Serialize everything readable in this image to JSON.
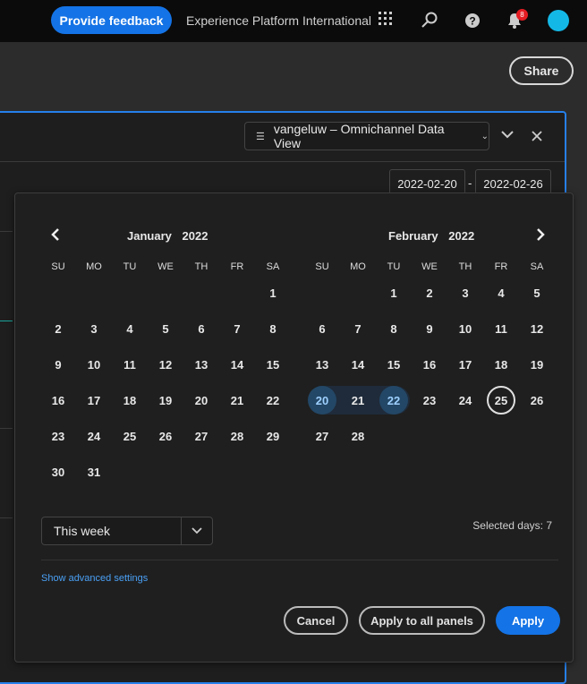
{
  "topbar": {
    "feedback_label": "Provide feedback",
    "org_name": "Experience Platform International",
    "notification_count": "8"
  },
  "toolbar": {
    "share_label": "Share"
  },
  "panel": {
    "data_view": "vangeluw – Omnichannel Data View",
    "start_date": "2022-02-20",
    "date_separator": "-",
    "end_date": "2022-02-26"
  },
  "calendar": {
    "weekdays": [
      "SU",
      "MO",
      "TU",
      "WE",
      "TH",
      "FR",
      "SA"
    ],
    "months": [
      {
        "month": "January",
        "year": "2022",
        "weeks": [
          [
            "",
            "",
            "",
            "",
            "",
            "",
            "1"
          ],
          [
            "2",
            "3",
            "4",
            "5",
            "6",
            "7",
            "8"
          ],
          [
            "9",
            "10",
            "11",
            "12",
            "13",
            "14",
            "15"
          ],
          [
            "16",
            "17",
            "18",
            "19",
            "20",
            "21",
            "22"
          ],
          [
            "23",
            "24",
            "25",
            "26",
            "27",
            "28",
            "29"
          ],
          [
            "30",
            "31",
            "",
            "",
            "",
            "",
            ""
          ]
        ]
      },
      {
        "month": "February",
        "year": "2022",
        "weeks": [
          [
            "",
            "",
            "1",
            "2",
            "3",
            "4",
            "5"
          ],
          [
            "6",
            "7",
            "8",
            "9",
            "10",
            "11",
            "12"
          ],
          [
            "13",
            "14",
            "15",
            "16",
            "17",
            "18",
            "19"
          ],
          [
            "20",
            "21",
            "22",
            "23",
            "24",
            "25",
            "26"
          ],
          [
            "27",
            "28",
            "",
            "",
            "",
            "",
            ""
          ]
        ]
      }
    ],
    "selected_start": "20",
    "selected_end": "22",
    "today": "25",
    "preset": "This week",
    "selected_days": "Selected days: 7",
    "advanced_label": "Show advanced settings",
    "cancel_label": "Cancel",
    "apply_all_label": "Apply to all panels",
    "apply_label": "Apply"
  },
  "colors": {
    "accent": "#1473e6",
    "range": "#1f2b3a",
    "selected": "#234766"
  }
}
